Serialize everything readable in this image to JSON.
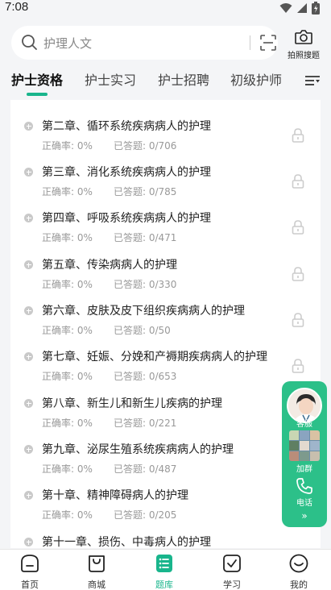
{
  "status_bar": {
    "time": "7:08"
  },
  "search": {
    "placeholder": "护理人文",
    "photo_search_label": "拍照搜题"
  },
  "tabs": [
    {
      "label": "护士资格",
      "active": true
    },
    {
      "label": "护士实习",
      "active": false
    },
    {
      "label": "护士招聘",
      "active": false
    },
    {
      "label": "初级护师",
      "active": false
    }
  ],
  "chapters": [
    {
      "title": "第二章、循环系统疾病病人的护理",
      "accuracy": "正确率: 0%",
      "answered": "已答题: 0/706"
    },
    {
      "title": "第三章、消化系统疾病病人的护理",
      "accuracy": "正确率: 0%",
      "answered": "已答题: 0/785"
    },
    {
      "title": "第四章、呼吸系统疾病病人的护理",
      "accuracy": "正确率: 0%",
      "answered": "已答题: 0/471"
    },
    {
      "title": "第五章、传染病病人的护理",
      "accuracy": "正确率: 0%",
      "answered": "已答题: 0/330"
    },
    {
      "title": "第六章、皮肤及皮下组织疾病病人的护理",
      "accuracy": "正确率: 0%",
      "answered": "已答题: 0/50"
    },
    {
      "title": "第七章、妊娠、分娩和产褥期疾病病人的护理",
      "accuracy": "正确率: 0%",
      "answered": "已答题: 0/653"
    },
    {
      "title": "第八章、新生儿和新生儿疾病的护理",
      "accuracy": "正确率: 0%",
      "answered": "已答题: 0/221"
    },
    {
      "title": "第九章、泌尿生殖系统疾病病人的护理",
      "accuracy": "正确率: 0%",
      "answered": "已答题: 0/487"
    },
    {
      "title": "第十章、精神障碍病人的护理",
      "accuracy": "正确率: 0%",
      "answered": "已答题: 0/205"
    },
    {
      "title": "第十一章、损伤、中毒病人的护理",
      "accuracy": "",
      "answered": ""
    }
  ],
  "float_panel": {
    "teacher_label": "客服",
    "group_label": "加群",
    "phone_label": "电话",
    "more": "»"
  },
  "bottom_nav": [
    {
      "label": "首页",
      "icon": "home-icon",
      "active": false
    },
    {
      "label": "商城",
      "icon": "shop-bag-icon",
      "active": false
    },
    {
      "label": "题库",
      "icon": "question-bank-icon",
      "active": true
    },
    {
      "label": "学习",
      "icon": "study-check-icon",
      "active": false
    },
    {
      "label": "我的",
      "icon": "profile-smile-icon",
      "active": false
    }
  ],
  "colors": {
    "accent": "#19b58c",
    "float_panel": "#2cc089",
    "background": "#f4f5f7"
  }
}
